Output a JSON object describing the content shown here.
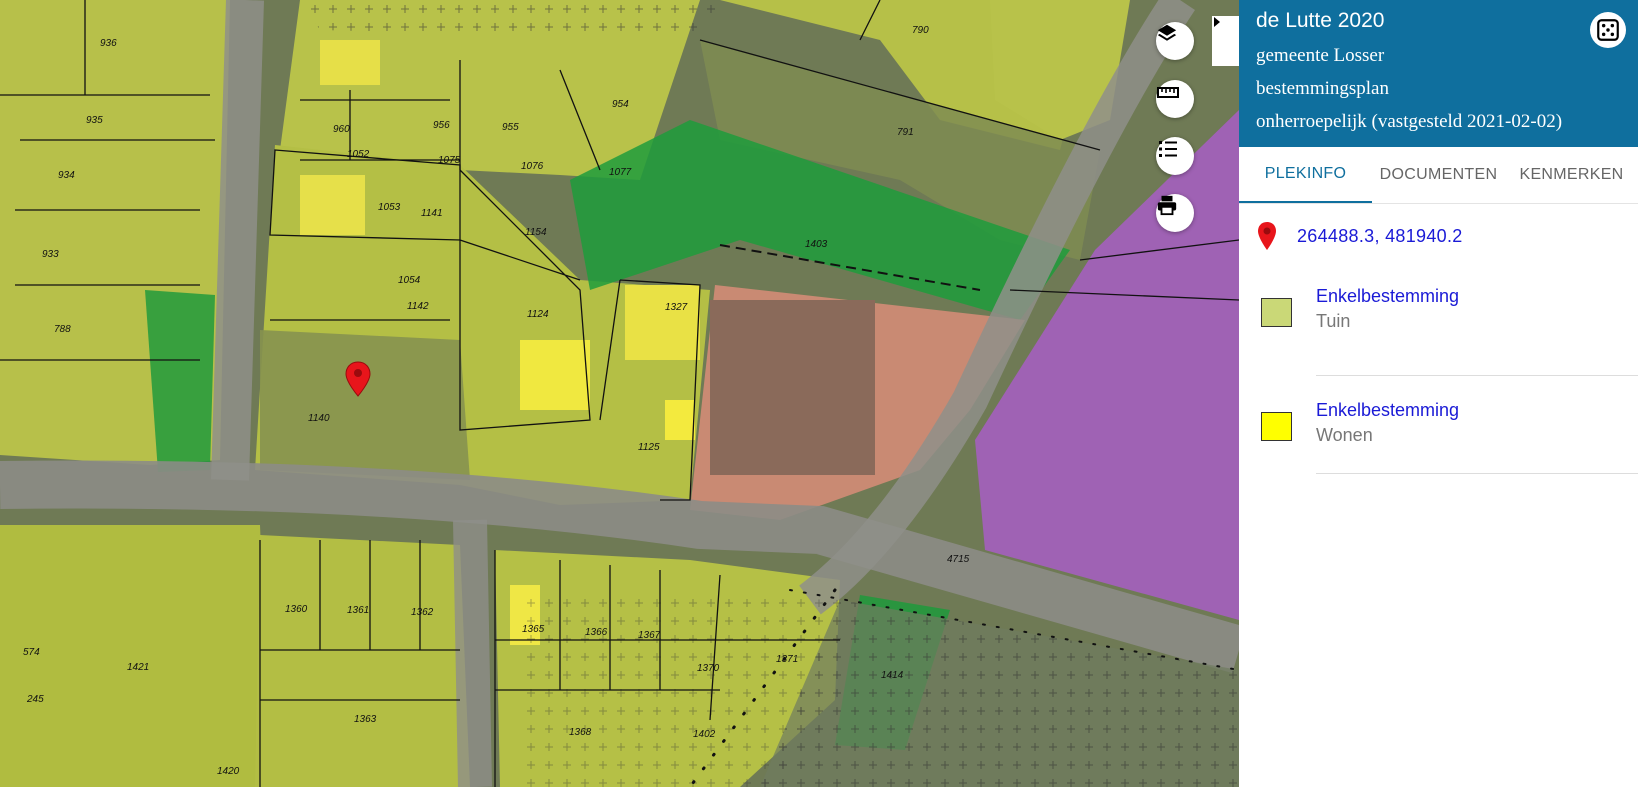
{
  "map": {
    "parcel_labels": [
      "936",
      "790",
      "954",
      "791",
      "935",
      "960",
      "956",
      "955",
      "1052",
      "1075",
      "1076",
      "1077",
      "934",
      "1053",
      "1141",
      "1154",
      "933",
      "1403",
      "1054",
      "1142",
      "1327",
      "788",
      "1124",
      "1140",
      "1125",
      "4715",
      "1360",
      "1361",
      "1362",
      "1365",
      "1366",
      "1367",
      "574",
      "1421",
      "1371",
      "1370",
      "1414",
      "245",
      "1363",
      "1368",
      "1402",
      "1420"
    ],
    "tools": [
      {
        "name": "layers-button",
        "icon": "layers-icon"
      },
      {
        "name": "measure-button",
        "icon": "ruler-icon"
      },
      {
        "name": "legend-list-button",
        "icon": "list-icon"
      },
      {
        "name": "print-button",
        "icon": "printer-icon"
      }
    ],
    "colors": {
      "tuin": "#c8d66e",
      "wonen": "#ffff00",
      "groen": "#1faa3a",
      "maatschappelijk": "#e8a08a",
      "gemengd": "#b26ee0"
    }
  },
  "panel": {
    "header": {
      "title": "de Lutte 2020",
      "municipality": "gemeente Losser",
      "plan_type": "bestemmingsplan",
      "status": "onherroepelijk (vastgesteld 2021-02-02)"
    },
    "tabs": [
      "PLEKINFO",
      "DOCUMENTEN",
      "KENMERKEN"
    ],
    "active_tab": "PLEKINFO",
    "coordinates": "264488.3, 481940.2",
    "legend": [
      {
        "title": "Enkelbestemming",
        "sub": "Tuin",
        "color": "#cad877"
      },
      {
        "title": "Enkelbestemming",
        "sub": "Wonen",
        "color": "#ffff00"
      }
    ]
  }
}
